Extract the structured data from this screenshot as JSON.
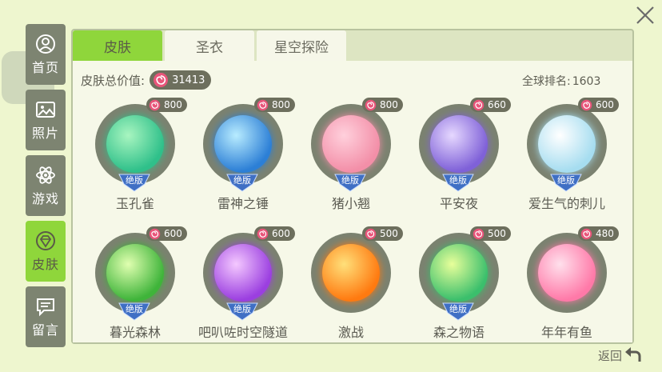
{
  "tabs": [
    {
      "label": "皮肤",
      "active": true
    },
    {
      "label": "圣衣",
      "active": false
    },
    {
      "label": "星空探险",
      "active": false
    }
  ],
  "sidebar": {
    "items": [
      {
        "label": "首页",
        "icon": "user-icon",
        "active": false
      },
      {
        "label": "照片",
        "icon": "photo-icon",
        "active": false
      },
      {
        "label": "游戏",
        "icon": "atom-icon",
        "active": false
      },
      {
        "label": "皮肤",
        "icon": "gem-icon",
        "active": true
      },
      {
        "label": "留言",
        "icon": "message-icon",
        "active": false
      }
    ]
  },
  "summary": {
    "total_label": "皮肤总价值:",
    "total_value": "31413",
    "rank_label": "全球排名:",
    "rank_value": "1603"
  },
  "skins": [
    {
      "name": "玉孔雀",
      "price": "800",
      "limited": "绝版",
      "color1": "#a8f5c0",
      "color2": "#2fc08a"
    },
    {
      "name": "雷神之锤",
      "price": "800",
      "limited": "绝版",
      "color1": "#b8ecff",
      "color2": "#2c7fd6"
    },
    {
      "name": "猪小翘",
      "price": "800",
      "limited": "绝版",
      "color1": "#ffd0dc",
      "color2": "#f38fa8"
    },
    {
      "name": "平安夜",
      "price": "660",
      "limited": "绝版",
      "color1": "#e6d8ff",
      "color2": "#7f61d8"
    },
    {
      "name": "爱生气的刺儿",
      "price": "600",
      "limited": "绝版",
      "color1": "#ffffff",
      "color2": "#a6ddf0"
    },
    {
      "name": "暮光森林",
      "price": "600",
      "limited": "绝版",
      "color1": "#e0ffb0",
      "color2": "#3fb43a"
    },
    {
      "name": "吧叭咗时空隧道",
      "price": "600",
      "limited": "绝版",
      "color1": "#f4c8ff",
      "color2": "#9b3fe0"
    },
    {
      "name": "激战",
      "price": "500",
      "limited": "",
      "color1": "#ffe07a",
      "color2": "#ff7a10"
    },
    {
      "name": "森之物语",
      "price": "500",
      "limited": "绝版",
      "color1": "#e8ff9a",
      "color2": "#3bbf6c"
    },
    {
      "name": "年年有鱼",
      "price": "480",
      "limited": "",
      "color1": "#ffe0ec",
      "color2": "#ff79a8"
    }
  ],
  "back_label": "返回",
  "colors": {
    "accent_green": "#8fd63b",
    "sidebar_gray": "#7d8471",
    "badge_dark": "#6d6f5d",
    "swirl_pink": "#e8557a"
  }
}
